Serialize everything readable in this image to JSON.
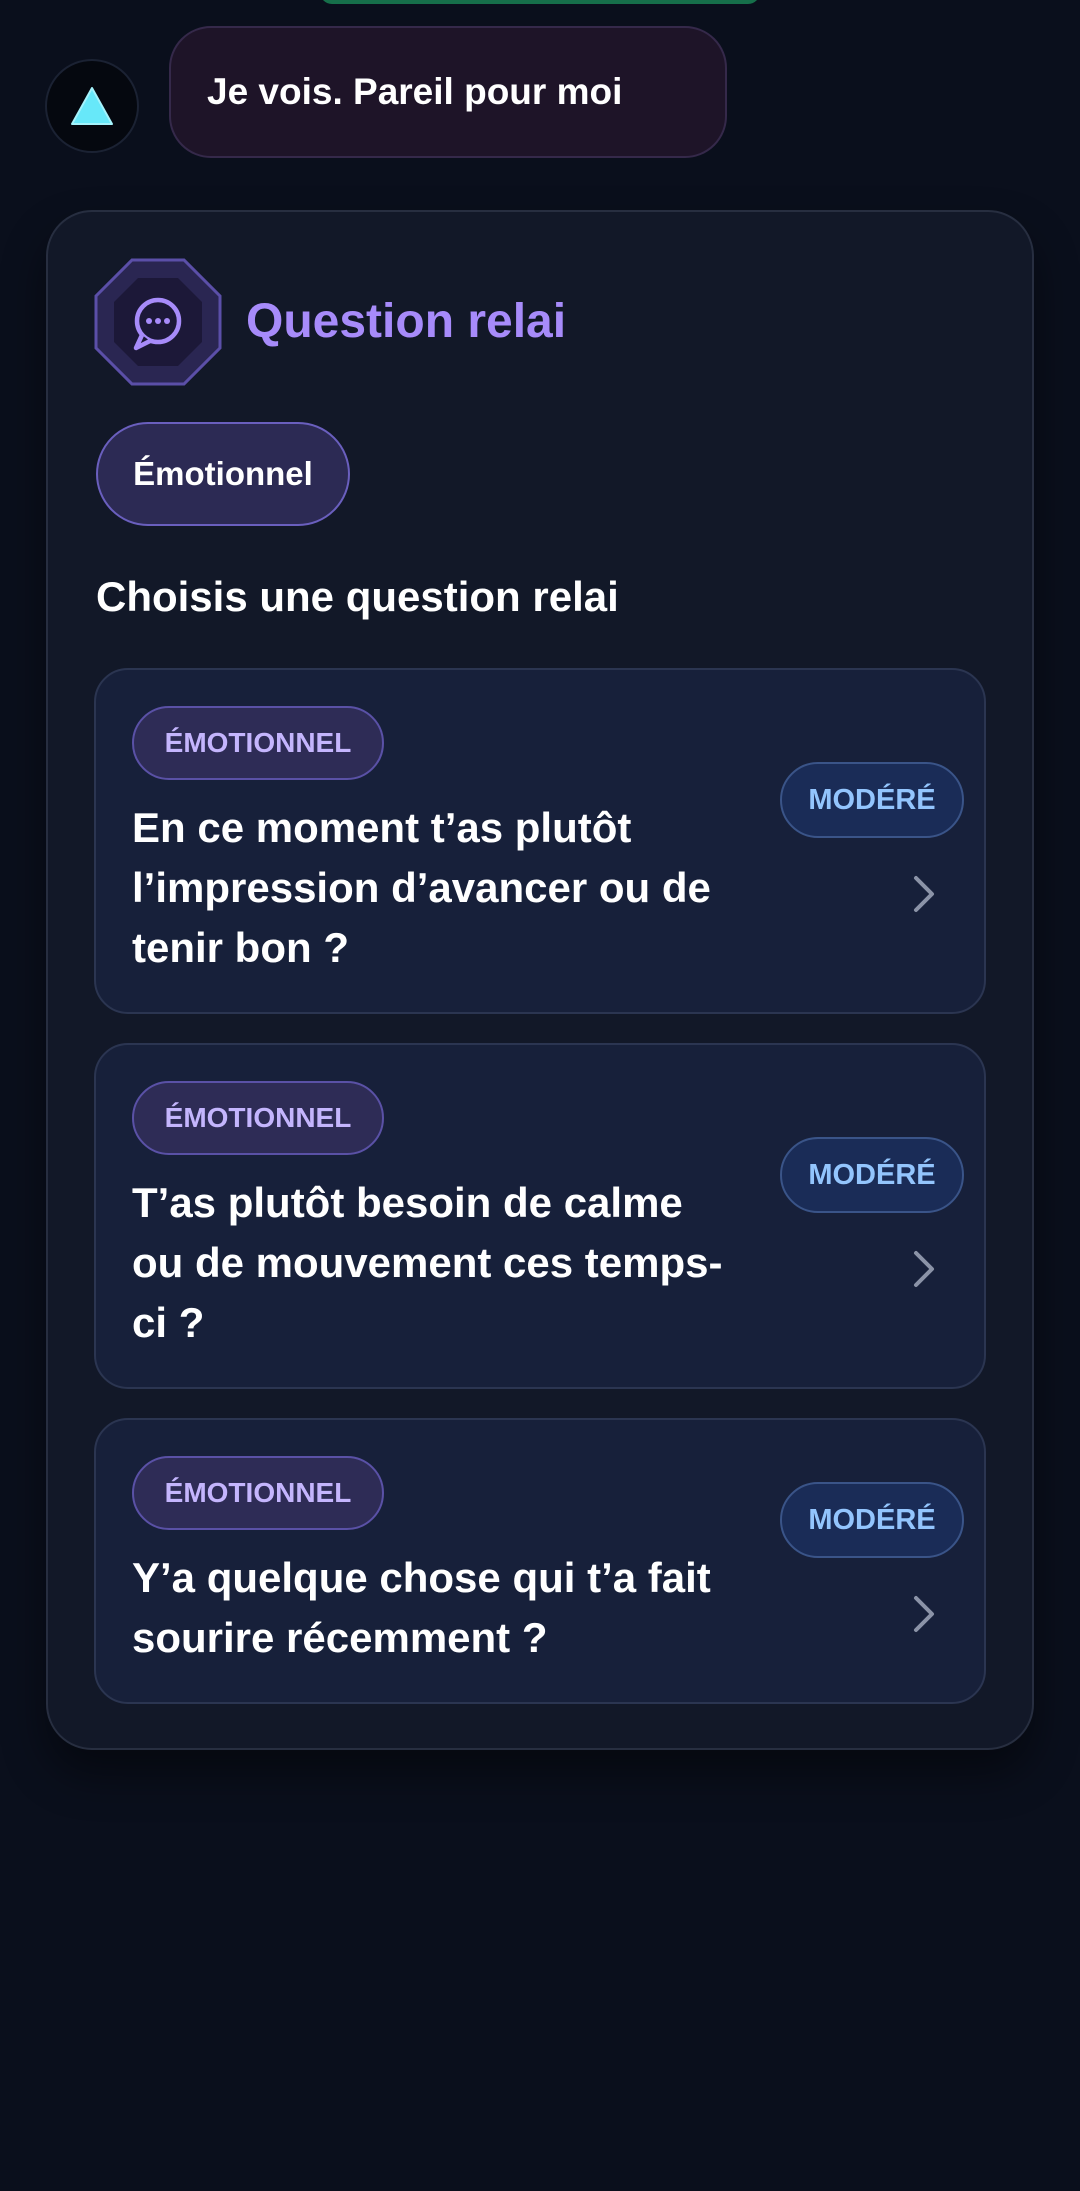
{
  "chat": {
    "message_text": "Je vois. Pareil pour moi",
    "avatar_icon": "triangle-icon"
  },
  "relay_card": {
    "title": "Question relai",
    "badge_icon": "chat-bubble-icon",
    "category_chip": "Émotionnel",
    "subtitle": "Choisis une question relai",
    "questions": [
      {
        "tag": "ÉMOTIONNEL",
        "level": "MODÉRÉ",
        "text": "En ce moment t’as plutôt l’impression d’avancer ou de tenir bon ?"
      },
      {
        "tag": "ÉMOTIONNEL",
        "level": "MODÉRÉ",
        "text": "T’as plutôt besoin de calme ou de mouvement ces temps-ci ?"
      },
      {
        "tag": "ÉMOTIONNEL",
        "level": "MODÉRÉ",
        "text": "Y’a quelque chose qui t’a fait sourire récemment ?"
      }
    ]
  },
  "colors": {
    "background": "#0a0f1c",
    "accent_purple": "#a78bfa",
    "level_blue": "#93c5fd",
    "avatar_cyan": "#67e8f9"
  }
}
